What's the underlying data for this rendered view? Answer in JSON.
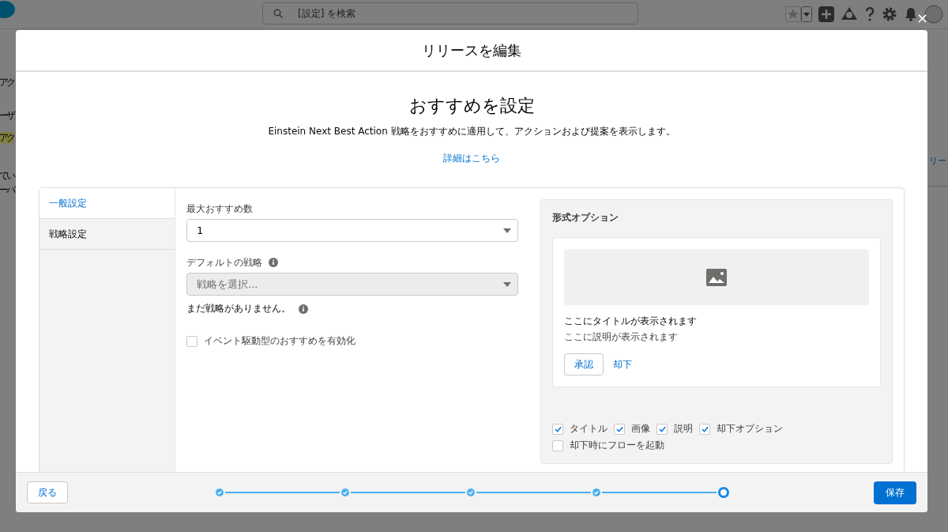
{
  "background": {
    "search": {
      "placeholder": "[設定] を検索"
    },
    "left_fragments": [
      {
        "text": "アク",
        "highlighted": false
      },
      {
        "text": "ーザ",
        "highlighted": false
      },
      {
        "text": "アク",
        "highlighted": true
      },
      {
        "text": "てい",
        "highlighted": false
      },
      {
        "text": "ーバ",
        "highlighted": false
      }
    ],
    "right_fragment": "リー"
  },
  "dialog": {
    "title": "リリースを編集",
    "close": "×",
    "heading": "おすすめを設定",
    "description": "Einstein Next Best Action 戦略をおすすめに適用して、アクションおよび提案を表示します。",
    "link": "詳細はこちら",
    "tabs": [
      {
        "label": "一般設定",
        "selected": true
      },
      {
        "label": "戦略設定",
        "selected": false
      }
    ],
    "max_recommendations": {
      "label": "最大おすすめ数",
      "value": "1"
    },
    "default_strategy": {
      "label": "デフォルトの戦略",
      "placeholder": "戦略を選択...",
      "disabled": true,
      "note": "まだ戦略がありません。"
    },
    "event_driven": {
      "label": "イベント駆動型のおすすめを有効化",
      "checked": false
    },
    "format_options": {
      "title": "形式オプション",
      "preview_title": "ここにタイトルが表示されます",
      "preview_description": "ここに説明が表示されます",
      "accept": "承認",
      "reject": "却下",
      "rows": [
        [
          {
            "label": "タイトル",
            "checked": true
          },
          {
            "label": "画像",
            "checked": true
          },
          {
            "label": "説明",
            "checked": true
          },
          {
            "label": "却下オプション",
            "checked": true
          }
        ],
        [
          {
            "label": "却下時にフローを起動",
            "checked": false
          }
        ]
      ]
    },
    "back": "戻る",
    "save": "保存",
    "steps": [
      {
        "kind": "complete"
      },
      {
        "kind": "complete"
      },
      {
        "kind": "complete"
      },
      {
        "kind": "complete"
      },
      {
        "kind": "current"
      }
    ]
  }
}
